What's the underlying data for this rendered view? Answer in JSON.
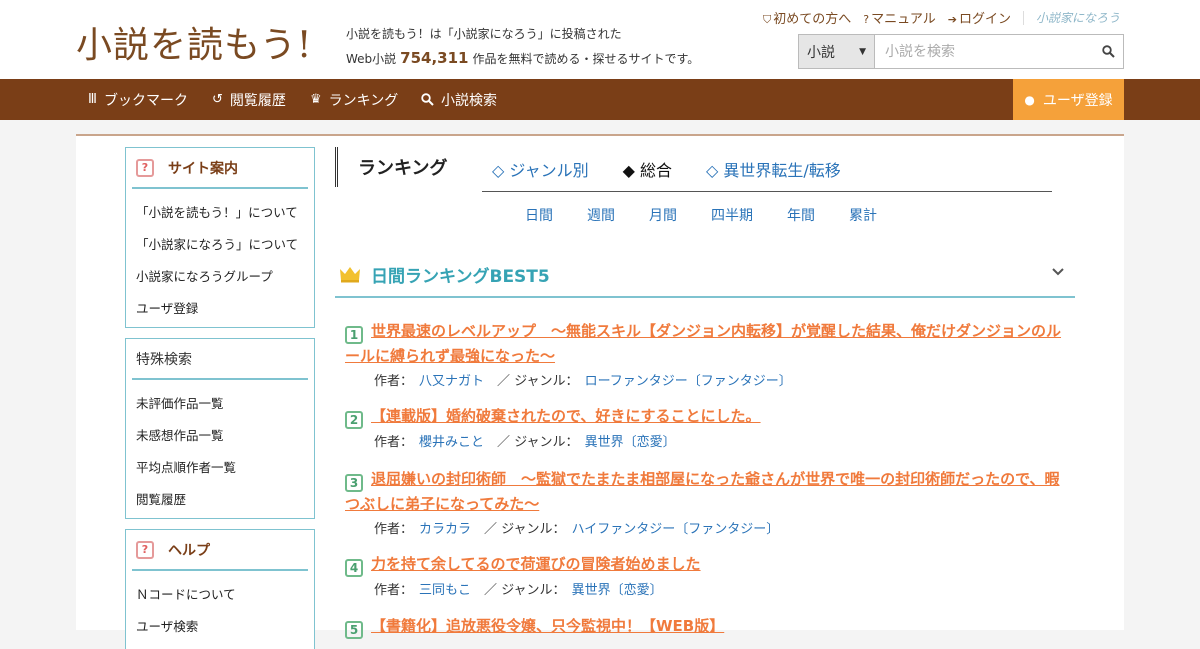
{
  "header": {
    "logo": "小説を読もう!",
    "tagline1": "小説を読もう！は「小説家になろう」に投稿された",
    "tagline2_pre": "Web小説",
    "work_count": "754,311",
    "tagline2_post": "作品を無料で読める・探せるサイトです。",
    "links": {
      "first_time": "初めての方へ",
      "manual": "マニュアル",
      "login": "ログイン",
      "brand": "小説家になろう"
    },
    "search": {
      "select_value": "小説",
      "placeholder": "小説を検索"
    }
  },
  "nav": {
    "bookmark": "ブックマーク",
    "history": "閲覧履歴",
    "ranking": "ランキング",
    "search": "小説検索",
    "register": "ユーザ登録"
  },
  "sidebar": {
    "site_guide": {
      "title": "サイト案内",
      "items": [
        "「小説を読もう！」について",
        "「小説家になろう」について",
        "小説家になろうグループ",
        "ユーザ登録"
      ]
    },
    "special_search": {
      "title": "特殊検索",
      "items": [
        "未評価作品一覧",
        "未感想作品一覧",
        "平均点順作者一覧",
        "閲覧履歴"
      ]
    },
    "help": {
      "title": "ヘルプ",
      "items": [
        "Ｎコードについて",
        "ユーザ検索"
      ]
    }
  },
  "ranking": {
    "heading": "ランキング",
    "tabs": [
      "◇ ジャンル別",
      "◆ 総合",
      "◇ 異世界転生/転移"
    ],
    "periods": [
      "日間",
      "週間",
      "月間",
      "四半期",
      "年間",
      "累計"
    ],
    "section_title": "日間ランキングBEST5",
    "author_label": "作者：",
    "genre_label": "ジャンル：",
    "sep": "／",
    "entries": [
      {
        "rank": "1",
        "title": "世界最速のレベルアップ　～無能スキル【ダンジョン内転移】が覚醒した結果、俺だけダンジョンのルールに縛られず最強になった～",
        "author": "八又ナガト",
        "genre": "ローファンタジー〔ファンタジー〕"
      },
      {
        "rank": "2",
        "title": "【連載版】婚約破棄されたので、好きにすることにした。",
        "author": "櫻井みこと",
        "genre": "異世界〔恋愛〕"
      },
      {
        "rank": "3",
        "title": "退屈嫌いの封印術師　～監獄でたまたま相部屋になった爺さんが世界で唯一の封印術師だったので、暇つぶしに弟子になってみた～",
        "author": "カラカラ",
        "genre": "ハイファンタジー〔ファンタジー〕"
      },
      {
        "rank": "4",
        "title": "力を持て余してるので荷運びの冒険者始めました",
        "author": "三同もこ",
        "genre": "異世界〔恋愛〕"
      },
      {
        "rank": "5",
        "title": "【書籍化】追放悪役令嬢、只今監視中！【WEB版】",
        "author": "",
        "genre": ""
      }
    ]
  },
  "colors": {
    "nav_bg": "#7a3e17",
    "register_bg": "#f5a13a",
    "accent_teal": "#7fc3d0",
    "title_orange": "#f07a3c",
    "link_blue": "#2a73b8"
  }
}
